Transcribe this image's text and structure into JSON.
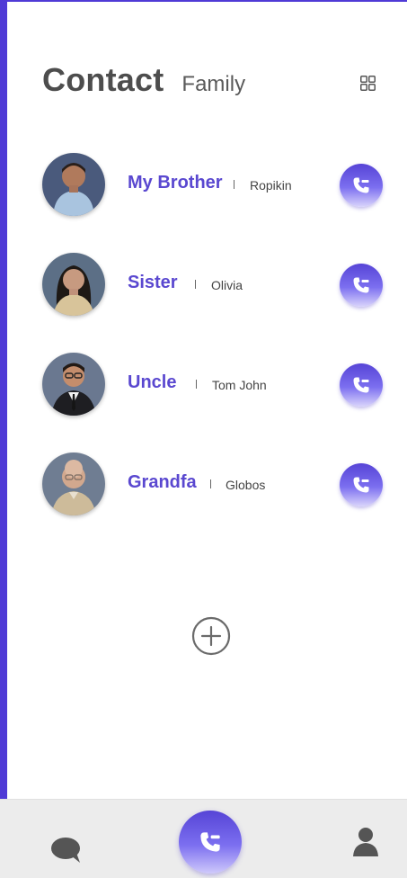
{
  "header": {
    "title": "Contact",
    "subtitle": "Family",
    "view_toggle_icon": "grid-icon"
  },
  "contacts": [
    {
      "name": "My Brother",
      "nickname": "Ropikin",
      "action_icon": "phone-icon"
    },
    {
      "name": "Sister",
      "nickname": "Olivia",
      "action_icon": "phone-icon"
    },
    {
      "name": "Uncle",
      "nickname": "Tom John",
      "action_icon": "phone-icon"
    },
    {
      "name": "Grandfa",
      "nickname": "Globos",
      "action_icon": "phone-icon"
    }
  ],
  "add_button_icon": "plus-circle-icon",
  "bottom_nav": {
    "items": [
      {
        "icon": "chat-icon"
      },
      {
        "icon": "phone-icon",
        "active": true
      },
      {
        "icon": "user-icon"
      }
    ]
  },
  "colors": {
    "accent": "#5644d6",
    "accent_light": "#7c6ff0",
    "frame": "#4f3ad6",
    "title_text": "#4d4d4d",
    "nav_background": "#ececec"
  }
}
